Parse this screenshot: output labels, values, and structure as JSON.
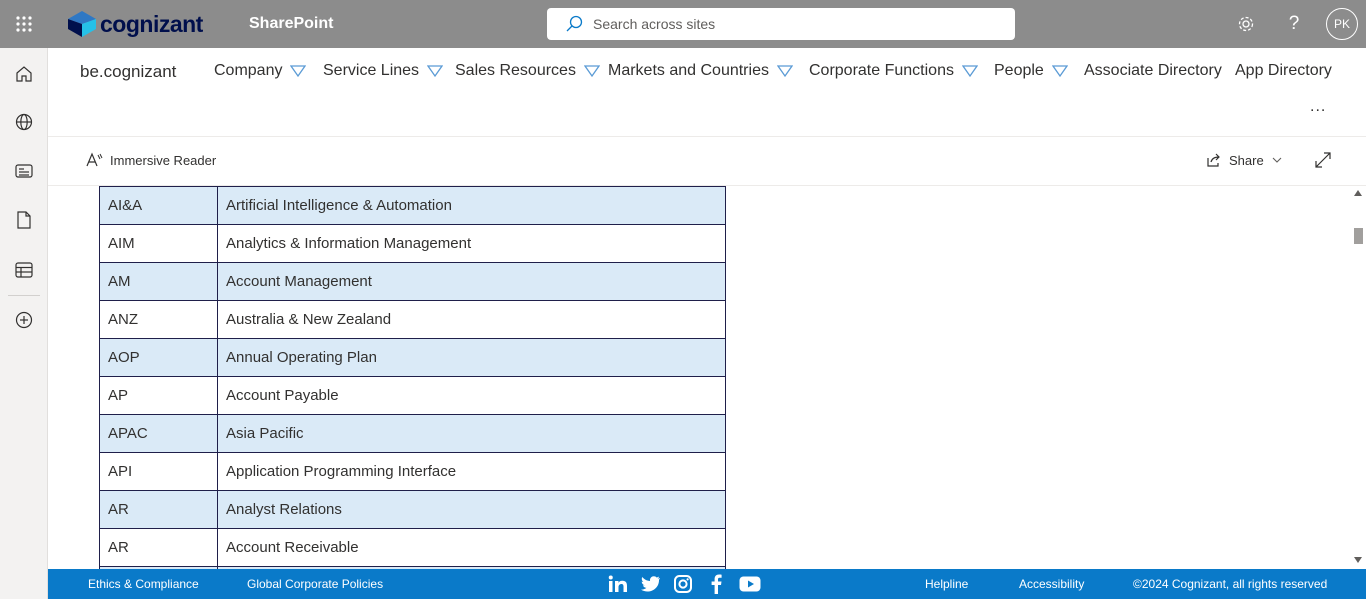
{
  "topbar": {
    "brand": "cognizant",
    "app_title": "SharePoint",
    "search_placeholder": "Search across sites",
    "avatar_initials": "PK"
  },
  "site": {
    "name": "be.cognizant",
    "nav": [
      {
        "label": "Company",
        "dropdown": true
      },
      {
        "label": "Service Lines",
        "dropdown": true
      },
      {
        "label": "Sales Resources",
        "dropdown": true
      },
      {
        "label": "Markets and Countries",
        "dropdown": true
      },
      {
        "label": "Corporate Functions",
        "dropdown": true
      },
      {
        "label": "People",
        "dropdown": true
      },
      {
        "label": "Associate Directory",
        "dropdown": false
      },
      {
        "label": "App Directory",
        "dropdown": false
      }
    ],
    "more": "..."
  },
  "commandbar": {
    "immersive_reader": "Immersive Reader",
    "share": "Share"
  },
  "table": {
    "rows": [
      {
        "abbr": "AI&A",
        "meaning": "Artificial Intelligence & Automation"
      },
      {
        "abbr": "AIM",
        "meaning": "Analytics & Information Management"
      },
      {
        "abbr": "AM",
        "meaning": "Account Management"
      },
      {
        "abbr": "ANZ",
        "meaning": "Australia & New Zealand"
      },
      {
        "abbr": "AOP",
        "meaning": "Annual Operating Plan"
      },
      {
        "abbr": "AP",
        "meaning": "Account Payable"
      },
      {
        "abbr": "APAC",
        "meaning": "Asia Pacific"
      },
      {
        "abbr": "API",
        "meaning": "Application Programming Interface"
      },
      {
        "abbr": "AR",
        "meaning": "Analyst Relations"
      },
      {
        "abbr": "AR",
        "meaning": "Account Receivable"
      },
      {
        "abbr": "",
        "meaning": ""
      }
    ]
  },
  "footer": {
    "ethics": "Ethics & Compliance",
    "policies": "Global Corporate Policies",
    "helpline": "Helpline",
    "accessibility": "Accessibility",
    "copyright": "©2024 Cognizant, all rights reserved",
    "social_icons": [
      "linkedin-icon",
      "twitter-icon",
      "instagram-icon",
      "facebook-icon",
      "youtube-icon"
    ]
  },
  "colors": {
    "topbar": "#8c8c8c",
    "footer": "#0a7ac9",
    "row_highlight": "#daeaf7",
    "nav_triangle": "#5b9bd5"
  }
}
